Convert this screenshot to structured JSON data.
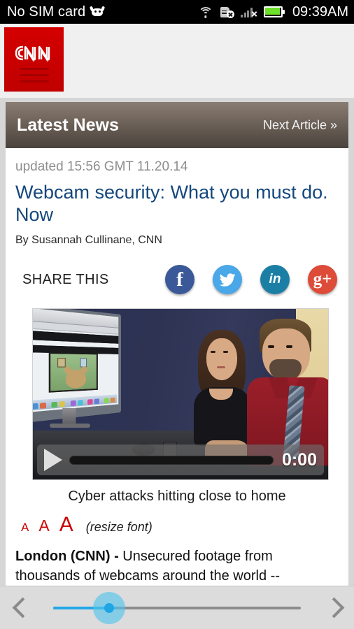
{
  "status_bar": {
    "carrier_text": "No SIM card",
    "time": "09:39AM",
    "icons": [
      "android-head-icon",
      "wifi-icon",
      "sync-disabled-icon",
      "signal-no-service-icon",
      "battery-icon"
    ]
  },
  "app_header": {
    "logo_text": "CNN",
    "logo_color": "#cc0000"
  },
  "news_bar": {
    "title": "Latest News",
    "next_label": "Next Article »"
  },
  "article": {
    "updated": "updated 15:56 GMT 11.20.14",
    "headline": "Webcam security: What you must do. Now",
    "byline": "By Susannah Cullinane, CNN",
    "share_label": "SHARE THIS",
    "share_icons": [
      {
        "name": "facebook-icon",
        "glyph": "f",
        "color": "#3b5998"
      },
      {
        "name": "twitter-icon",
        "glyph": "",
        "color": "#4aa7e8"
      },
      {
        "name": "linkedin-icon",
        "glyph": "in",
        "color": "#1b7fa5"
      },
      {
        "name": "googleplus-icon",
        "glyph": "g+",
        "color": "#dd4b39"
      }
    ],
    "video": {
      "time": "0:00",
      "caption": "Cyber attacks hitting close to home"
    },
    "resize": {
      "small": "A",
      "medium": "A",
      "large": "A",
      "label": "(resize font)"
    },
    "body_lead": "London (CNN) - ",
    "body_text": "Unsecured footage from thousands of webcams around the world -- including in the"
  },
  "bottom_nav": {
    "prev_icon": "chevron-left-icon",
    "next_icon": "chevron-right-icon",
    "slider_value": 24
  }
}
